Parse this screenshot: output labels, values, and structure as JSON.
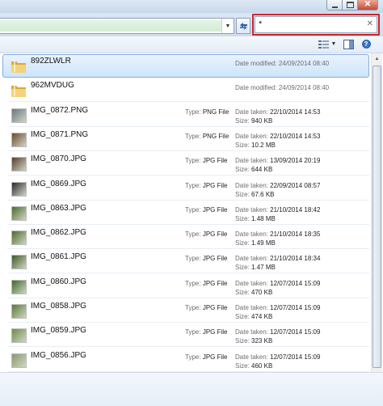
{
  "search": {
    "value": "*"
  },
  "files": [
    {
      "kind": "folder",
      "name": "892ZLWLR",
      "modified_label": "Date modified:",
      "modified": "24/09/2014 08:40",
      "selected": true
    },
    {
      "kind": "folder",
      "name": "962MVDUG",
      "modified_label": "Date modified:",
      "modified": "24/09/2014 08:40"
    },
    {
      "kind": "image",
      "thumb": "#6a7585",
      "name": "IMG_0872.PNG",
      "type_label": "Type:",
      "type": "PNG File",
      "taken_label": "Date taken:",
      "taken": "22/10/2014 14:53",
      "size_label": "Size:",
      "size": "940 KB"
    },
    {
      "kind": "image",
      "thumb": "#6b4a2d",
      "name": "IMG_0871.PNG",
      "type_label": "Type:",
      "type": "PNG File",
      "taken_label": "Date taken:",
      "taken": "22/10/2014 14:53",
      "size_label": "Size:",
      "size": "10.2 MB"
    },
    {
      "kind": "image",
      "thumb": "#5a3c2a",
      "name": "IMG_0870.JPG",
      "type_label": "Type:",
      "type": "JPG File",
      "taken_label": "Date taken:",
      "taken": "13/09/2014 20:19",
      "size_label": "Size:",
      "size": "644 KB"
    },
    {
      "kind": "image",
      "thumb": "#2b2b2b",
      "name": "IMG_0869.JPG",
      "type_label": "Type:",
      "type": "JPG File",
      "taken_label": "Date taken:",
      "taken": "22/09/2014 08:57",
      "size_label": "Size:",
      "size": "67.6 KB"
    },
    {
      "kind": "image",
      "thumb": "#4c6b2f",
      "name": "IMG_0863.JPG",
      "type_label": "Type:",
      "type": "JPG File",
      "taken_label": "Date taken:",
      "taken": "21/10/2014 18:42",
      "size_label": "Size:",
      "size": "1.48 MB"
    },
    {
      "kind": "image",
      "thumb": "#4f6a2b",
      "name": "IMG_0862.JPG",
      "type_label": "Type:",
      "type": "JPG File",
      "taken_label": "Date taken:",
      "taken": "21/10/2014 18:35",
      "size_label": "Size:",
      "size": "1.49 MB"
    },
    {
      "kind": "image",
      "thumb": "#3d5a26",
      "name": "IMG_0861.JPG",
      "type_label": "Type:",
      "type": "JPG File",
      "taken_label": "Date taken:",
      "taken": "21/10/2014 18:34",
      "size_label": "Size:",
      "size": "1.47 MB"
    },
    {
      "kind": "image",
      "thumb": "#3f6a2a",
      "name": "IMG_0860.JPG",
      "type_label": "Type:",
      "type": "JPG File",
      "taken_label": "Date taken:",
      "taken": "12/07/2014 15:09",
      "size_label": "Size:",
      "size": "470 KB"
    },
    {
      "kind": "image",
      "thumb": "#5a7a3a",
      "name": "IMG_0858.JPG",
      "type_label": "Type:",
      "type": "JPG File",
      "taken_label": "Date taken:",
      "taken": "12/07/2014 15:09",
      "size_label": "Size:",
      "size": "474 KB"
    },
    {
      "kind": "image",
      "thumb": "#6f8a4a",
      "name": "IMG_0859.JPG",
      "type_label": "Type:",
      "type": "JPG File",
      "taken_label": "Date taken:",
      "taken": "12/07/2014 15:09",
      "size_label": "Size:",
      "size": "323 KB"
    },
    {
      "kind": "image",
      "thumb": "#8a9a6a",
      "name": "IMG_0856.JPG",
      "type_label": "Type:",
      "type": "JPG File",
      "taken_label": "Date taken:",
      "taken": "12/07/2014 15:09",
      "size_label": "Size:",
      "size": "460 KB"
    }
  ],
  "colors": {
    "search_highlight": "#c9272b",
    "selection": "#cde4fb",
    "folder": "#e8c14f"
  },
  "icons": {
    "refresh": "refresh-icon",
    "clear": "clear-search-icon",
    "views": "views-icon",
    "preview_pane": "preview-pane-icon",
    "help": "help-icon",
    "folder": "folder-icon"
  }
}
